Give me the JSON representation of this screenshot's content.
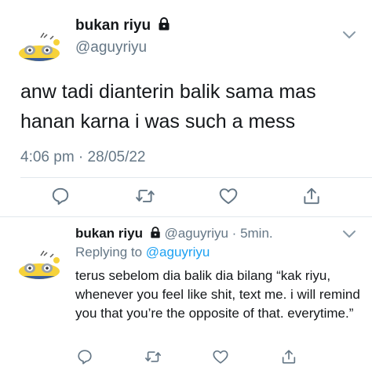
{
  "main_tweet": {
    "display_name": "bukan riyu",
    "handle": "@aguyriyu",
    "text": "anw tadi dianterin balik sama mas hanan karna i was such a mess",
    "timestamp": "4:06 pm · 28/05/22",
    "icons": {
      "reply": "comment-icon",
      "retweet": "retweet-icon",
      "like": "heart-icon",
      "share": "share-icon",
      "menu": "chevron-down-icon",
      "protected": "lock-icon"
    }
  },
  "reply_tweet": {
    "display_name": "bukan riyu",
    "handle": "@aguyriyu",
    "separator": " · ",
    "time": "5min.",
    "replying_prefix": "Replying to ",
    "replying_to": "@aguyriyu",
    "text": "terus sebelom dia balik dia bilang “kak riyu, whenever you feel like shit, text me. i will remind you that you’re the opposite of that. everytime.”"
  },
  "colors": {
    "text_primary": "#14171a",
    "text_secondary": "#657786",
    "link": "#1da1f2",
    "divider": "#e1e8ed"
  }
}
